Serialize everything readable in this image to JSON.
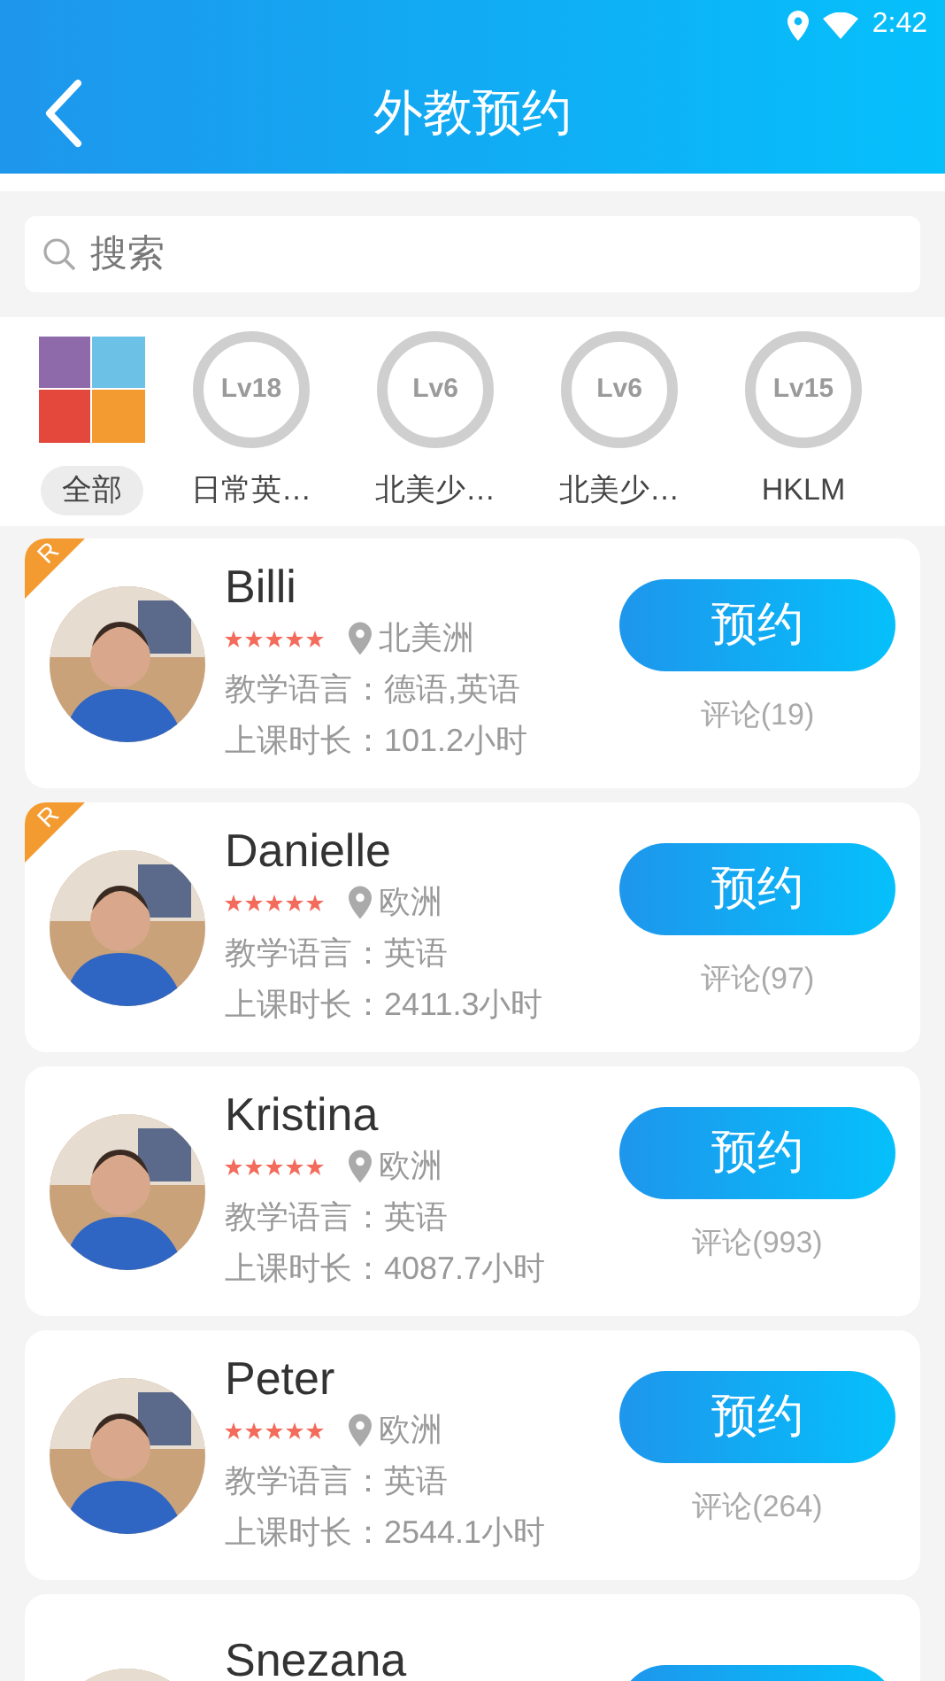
{
  "status_bar": {
    "time": "2:42"
  },
  "header": {
    "title": "外教预约"
  },
  "search": {
    "placeholder": "搜索"
  },
  "categories": [
    {
      "kind": "all",
      "label": "全部",
      "selected": true
    },
    {
      "kind": "level",
      "level_text": "Lv18",
      "label": "日常英…",
      "selected": false
    },
    {
      "kind": "level",
      "level_text": "Lv6",
      "label": "北美少…",
      "selected": false
    },
    {
      "kind": "level",
      "level_text": "Lv6",
      "label": "北美少…",
      "selected": false
    },
    {
      "kind": "level",
      "level_text": "Lv15",
      "label": "HKLM",
      "selected": false
    }
  ],
  "teachers": [
    {
      "name": "Billi",
      "recommended": true,
      "badge": "R",
      "stars": 5,
      "region": "北美洲",
      "languages": "教学语言：德语,英语",
      "hours": "上课时长：101.2小时",
      "button": "预约",
      "comments": "评论(19)"
    },
    {
      "name": "Danielle",
      "recommended": true,
      "badge": "R",
      "stars": 5,
      "region": "欧洲",
      "languages": "教学语言：英语",
      "hours": "上课时长：2411.3小时",
      "button": "预约",
      "comments": "评论(97)"
    },
    {
      "name": "Kristina",
      "recommended": false,
      "stars": 5,
      "region": "欧洲",
      "languages": "教学语言：英语",
      "hours": "上课时长：4087.7小时",
      "button": "预约",
      "comments": "评论(993)"
    },
    {
      "name": "Peter",
      "recommended": false,
      "stars": 5,
      "region": "欧洲",
      "languages": "教学语言：英语",
      "hours": "上课时长：2544.1小时",
      "button": "预约",
      "comments": "评论(264)"
    },
    {
      "name": "Snezana",
      "recommended": false
    }
  ]
}
